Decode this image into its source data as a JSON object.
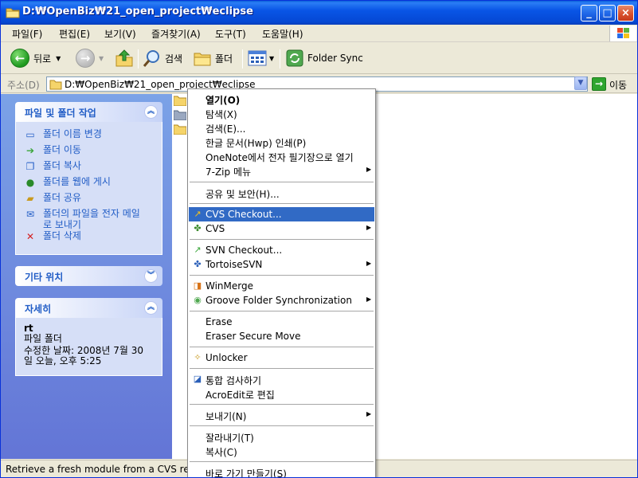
{
  "window": {
    "title": "D:₩OpenBiz₩21_open_project₩eclipse",
    "minimize_glyph": "_",
    "maximize_glyph": "□",
    "close_glyph": "×"
  },
  "menubar": {
    "items": [
      "파일(F)",
      "편집(E)",
      "보기(V)",
      "즐겨찾기(A)",
      "도구(T)",
      "도움말(H)"
    ]
  },
  "toolbar": {
    "back_label": "뒤로",
    "search_label": "검색",
    "folders_label": "폴더",
    "folder_sync_label": "Folder Sync"
  },
  "address": {
    "label": "주소(D)",
    "value": "D:₩OpenBiz₩21_open_project₩eclipse",
    "go_label": "이동"
  },
  "taskpane": {
    "file_tasks": {
      "title": "파일 및 폴더 작업",
      "items": [
        {
          "label": "폴더 이름 변경",
          "icon": "rename-icon"
        },
        {
          "label": "폴더 이동",
          "icon": "move-icon"
        },
        {
          "label": "폴더 복사",
          "icon": "copy-icon"
        },
        {
          "label": "폴더를 웹에 게시",
          "icon": "publish-web-icon"
        },
        {
          "label": "폴더 공유",
          "icon": "share-icon"
        },
        {
          "label": "폴더의 파일을 전자 메일로 보내기",
          "icon": "email-icon"
        },
        {
          "label": "폴더 삭제",
          "icon": "delete-icon"
        }
      ]
    },
    "other_places": {
      "title": "기타 위치"
    },
    "details": {
      "title": "자세히",
      "name": "rt",
      "type": "파일 폴더",
      "modified_line1": "수정한 날짜: 2008년 7월 30",
      "modified_line2": "일 오늘, 오후 5:25"
    }
  },
  "status": {
    "text": "Retrieve a fresh module from a CVS repo"
  },
  "context_menu": {
    "items": [
      {
        "label": "열기(O)",
        "bold": true
      },
      {
        "label": "탐색(X)"
      },
      {
        "label": "검색(E)..."
      },
      {
        "label": "한글 문서(Hwp) 인쇄(P)"
      },
      {
        "label": "OneNote에서 전자 필기장으로 열기"
      },
      {
        "label": "7-Zip 메뉴",
        "submenu": true
      },
      {
        "label": "공유 및 보안(H)..."
      },
      {
        "label": "CVS Checkout...",
        "icon": "cvs-checkout-icon",
        "highlighted": true
      },
      {
        "label": "CVS",
        "icon": "cvs-turtle-icon",
        "submenu": true
      },
      {
        "label": "SVN Checkout...",
        "icon": "svn-checkout-icon"
      },
      {
        "label": "TortoiseSVN",
        "icon": "tortoise-svn-icon",
        "submenu": true
      },
      {
        "label": "WinMerge",
        "icon": "winmerge-icon"
      },
      {
        "label": "Groove Folder Synchronization",
        "icon": "groove-icon",
        "submenu": true
      },
      {
        "label": "Erase"
      },
      {
        "label": "Eraser Secure Move"
      },
      {
        "label": "Unlocker",
        "icon": "unlocker-icon"
      },
      {
        "label": "통합 검사하기",
        "icon": "scan-icon"
      },
      {
        "label": "AcroEdit로 편집"
      },
      {
        "label": "보내기(N)",
        "submenu": true
      },
      {
        "label": "잘라내기(T)"
      },
      {
        "label": "복사(C)"
      },
      {
        "label": "바로 가기 만들기(S)"
      }
    ]
  },
  "colors": {
    "titlebar": "#0955e6",
    "taskpane": "#7ba2e7",
    "highlight": "#316ac5",
    "task_link": "#215dc6"
  }
}
